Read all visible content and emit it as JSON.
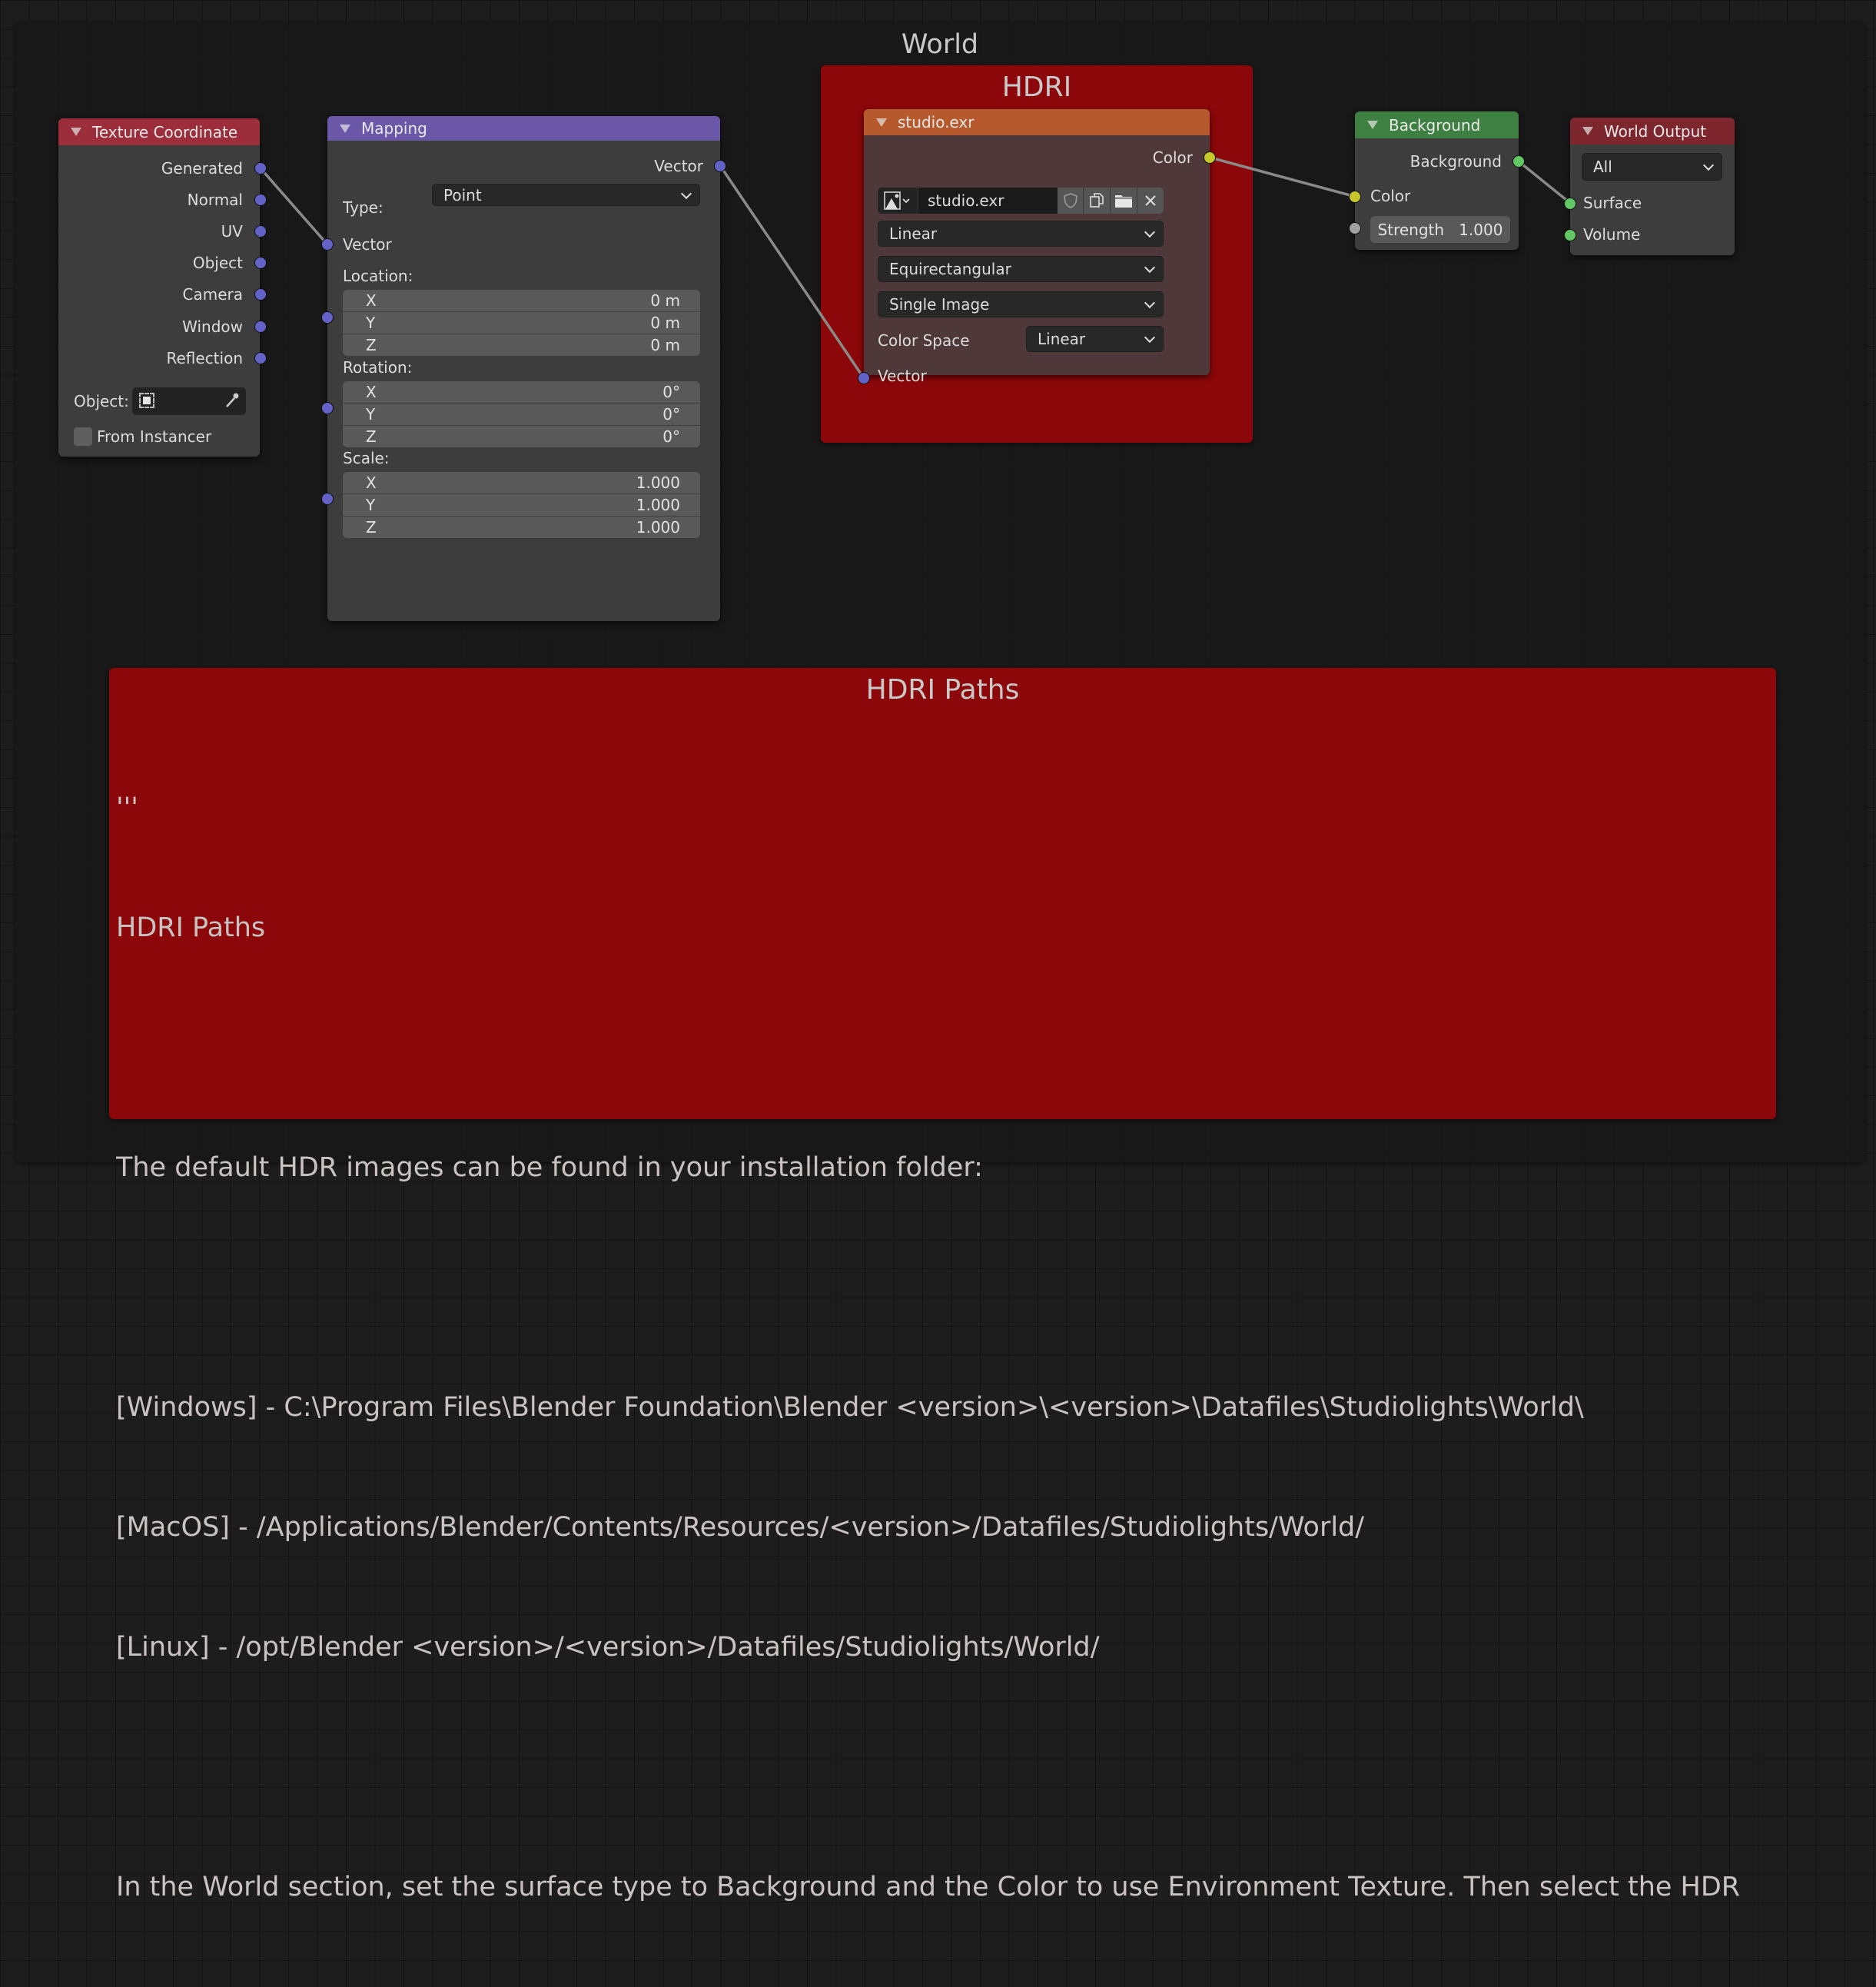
{
  "frames": {
    "world": {
      "title": "World"
    },
    "hdri": {
      "title": "HDRI"
    },
    "notes": {
      "title": "HDRI Paths",
      "lines": [
        "'''",
        "HDRI Paths",
        "",
        "The default HDR images can be found in your installation folder:",
        "",
        "[Windows] - C:\\Program Files\\Blender Foundation\\Blender <version>\\<version>\\Datafiles\\Studiolights\\World\\",
        "[MacOS] - /Applications/Blender/Contents/Resources/<version>/Datafiles/Studiolights/World/",
        "[Linux] - /opt/Blender <version>/<version>/Datafiles/Studiolights/World/",
        "",
        "In the World section, set the surface type to Background and the Color to use Environment Texture. Then select the HDR"
      ]
    }
  },
  "nodes": {
    "texture_coordinate": {
      "title": "Texture Coordinate",
      "header_color": "#9c2d3a",
      "outputs": [
        "Generated",
        "Normal",
        "UV",
        "Object",
        "Camera",
        "Window",
        "Reflection"
      ],
      "object_label": "Object:",
      "object_value": "",
      "from_instancer_label": "From Instancer",
      "from_instancer_checked": false
    },
    "mapping": {
      "title": "Mapping",
      "header_color": "#6b57a8",
      "output": "Vector",
      "type_label": "Type:",
      "type_value": "Point",
      "input_vector": "Vector",
      "location_label": "Location:",
      "location": [
        {
          "axis": "X",
          "value": "0 m"
        },
        {
          "axis": "Y",
          "value": "0 m"
        },
        {
          "axis": "Z",
          "value": "0 m"
        }
      ],
      "rotation_label": "Rotation:",
      "rotation": [
        {
          "axis": "X",
          "value": "0°"
        },
        {
          "axis": "Y",
          "value": "0°"
        },
        {
          "axis": "Z",
          "value": "0°"
        }
      ],
      "scale_label": "Scale:",
      "scale": [
        {
          "axis": "X",
          "value": "1.000"
        },
        {
          "axis": "Y",
          "value": "1.000"
        },
        {
          "axis": "Z",
          "value": "1.000"
        }
      ]
    },
    "environment_texture": {
      "title": "studio.exr",
      "header_color": "#b65a2e",
      "output": "Color",
      "image_name": "studio.exr",
      "interpolation": "Linear",
      "projection": "Equirectangular",
      "source": "Single Image",
      "color_space_label": "Color Space",
      "color_space": "Linear",
      "input_vector": "Vector",
      "icons": [
        "image-browse-icon",
        "fake-user-shield-icon",
        "duplicate-icon",
        "open-folder-icon",
        "unlink-x-icon"
      ]
    },
    "background": {
      "title": "Background",
      "header_color": "#3e8042",
      "output": "Background",
      "input_color": "Color",
      "strength_label": "Strength",
      "strength_value": "1.000"
    },
    "world_output": {
      "title": "World Output",
      "header_color": "#7e262d",
      "target": "All",
      "input_surface": "Surface",
      "input_volume": "Volume"
    }
  },
  "colors": {
    "socket_vector": "#6363c7",
    "socket_color": "#c7c729",
    "socket_shader": "#63c763",
    "socket_float": "#a1a1a1",
    "frame_red": "#8b0709",
    "link": "#8a8a8a"
  }
}
